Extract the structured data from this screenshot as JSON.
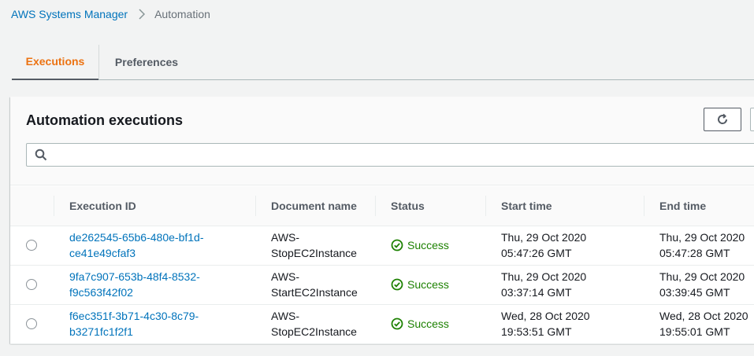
{
  "breadcrumb": {
    "parent": "AWS Systems Manager",
    "current": "Automation"
  },
  "tabs": [
    {
      "label": "Executions"
    },
    {
      "label": "Preferences"
    }
  ],
  "panel": {
    "title": "Automation executions",
    "refresh_icon": "refresh-icon"
  },
  "search": {
    "placeholder": "",
    "icon": "search-icon"
  },
  "table": {
    "columns": [
      "Execution ID",
      "Document name",
      "Status",
      "Start time",
      "End time"
    ],
    "rows": [
      {
        "id_line1": "de262545-65b6-480e-bf1d-",
        "id_line2": "ce41e49cfaf3",
        "doc_line1": "AWS-",
        "doc_line2": "StopEC2Instance",
        "status": "Success",
        "start_line1": "Thu, 29 Oct 2020",
        "start_line2": "05:47:26 GMT",
        "end_line1": "Thu, 29 Oct 2020",
        "end_line2": "05:47:28 GMT"
      },
      {
        "id_line1": "9fa7c907-653b-48f4-8532-",
        "id_line2": "f9c563f42f02",
        "doc_line1": "AWS-",
        "doc_line2": "StartEC2Instance",
        "status": "Success",
        "start_line1": "Thu, 29 Oct 2020",
        "start_line2": "03:37:14 GMT",
        "end_line1": "Thu, 29 Oct 2020",
        "end_line2": "03:39:45 GMT"
      },
      {
        "id_line1": "f6ec351f-3b71-4c30-8c79-",
        "id_line2": "b3271fc1f2f1",
        "doc_line1": "AWS-",
        "doc_line2": "StopEC2Instance",
        "status": "Success",
        "start_line1": "Wed, 28 Oct 2020",
        "start_line2": "19:53:51 GMT",
        "end_line1": "Wed, 28 Oct 2020",
        "end_line2": "19:55:01 GMT"
      }
    ]
  },
  "colors": {
    "link": "#0073bb",
    "active_tab": "#ec7211",
    "success": "#1d8102"
  }
}
